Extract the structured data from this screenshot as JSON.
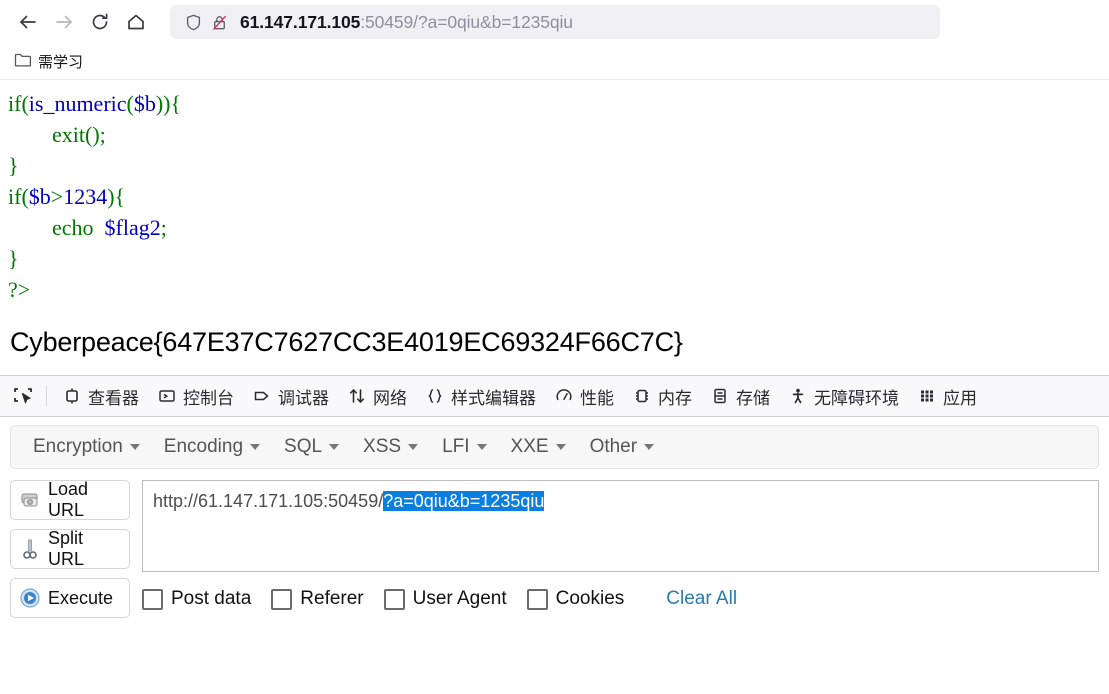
{
  "browser": {
    "nav": {
      "back_label": "Back",
      "forward_label": "Forward",
      "reload_label": "Reload",
      "home_label": "Home"
    },
    "urlbar": {
      "shield_icon": "shield-icon",
      "lock_icon": "lock-crossed-icon",
      "host": "61.147.171.105",
      "rest": ":50459/?a=0qiu&b=1235qiu",
      "full_url": "61.147.171.105:50459/?a=0qiu&b=1235qiu"
    },
    "bookmarks": [
      {
        "icon": "folder-icon",
        "label": "需学习"
      }
    ]
  },
  "page": {
    "code_lines": [
      [
        {
          "t": "if(",
          "c": "green"
        },
        {
          "t": "is_numeric",
          "c": "blue"
        },
        {
          "t": "(",
          "c": "green"
        },
        {
          "t": "$b",
          "c": "blue"
        },
        {
          "t": ")){",
          "c": "green"
        }
      ],
      [
        {
          "t": "        exit();",
          "c": "green"
        }
      ],
      [
        {
          "t": "}",
          "c": "green"
        }
      ],
      [
        {
          "t": "if(",
          "c": "green"
        },
        {
          "t": "$b",
          "c": "blue"
        },
        {
          "t": ">",
          "c": "green"
        },
        {
          "t": "1234",
          "c": "blue"
        },
        {
          "t": "){",
          "c": "green"
        }
      ],
      [
        {
          "t": "        echo  ",
          "c": "green"
        },
        {
          "t": "$flag2",
          "c": "blue"
        },
        {
          "t": ";",
          "c": "green"
        }
      ],
      [
        {
          "t": "}",
          "c": "green"
        }
      ],
      [
        {
          "t": "?>",
          "c": "green"
        }
      ]
    ],
    "flag": "Cyberpeace{647E37C7627CC3E4019EC69324F66C7C}"
  },
  "devtools": {
    "picker_label": "选择元素",
    "tabs": [
      {
        "icon": "inspector-icon",
        "label": "查看器"
      },
      {
        "icon": "console-icon",
        "label": "控制台"
      },
      {
        "icon": "debugger-icon",
        "label": "调试器"
      },
      {
        "icon": "network-icon",
        "label": "网络"
      },
      {
        "icon": "style-editor-icon",
        "label": "样式编辑器"
      },
      {
        "icon": "performance-icon",
        "label": "性能"
      },
      {
        "icon": "memory-icon",
        "label": "内存"
      },
      {
        "icon": "storage-icon",
        "label": "存储"
      },
      {
        "icon": "accessibility-icon",
        "label": "无障碍环境"
      },
      {
        "icon": "application-icon",
        "label": "应用"
      }
    ]
  },
  "hackbar": {
    "menus": [
      {
        "label": "Encryption"
      },
      {
        "label": "Encoding"
      },
      {
        "label": "SQL"
      },
      {
        "label": "XSS"
      },
      {
        "label": "LFI"
      },
      {
        "label": "XXE"
      },
      {
        "label": "Other"
      }
    ],
    "buttons": [
      {
        "icon": "load-url-icon",
        "label": "Load URL"
      },
      {
        "icon": "split-url-icon",
        "label": "Split URL"
      },
      {
        "icon": "execute-icon",
        "label": "Execute"
      }
    ],
    "url_field": {
      "prefix": "http://61.147.171.105:50459/",
      "selected": "?a=0qiu&b=1235qiu",
      "value": "http://61.147.171.105:50459/?a=0qiu&b=1235qiu"
    },
    "checkboxes": [
      {
        "label": "Post data",
        "checked": false
      },
      {
        "label": "Referer",
        "checked": false
      },
      {
        "label": "User Agent",
        "checked": false
      },
      {
        "label": "Cookies",
        "checked": false
      }
    ],
    "clear_all_label": "Clear All"
  },
  "colors": {
    "code_green": "#007700",
    "code_blue": "#0000bb",
    "selection_blue": "#0b7fe0",
    "link_blue": "#2a7ab0",
    "devtools_bg": "#f9f9fb",
    "urlbar_bg": "#f0f0f4"
  }
}
